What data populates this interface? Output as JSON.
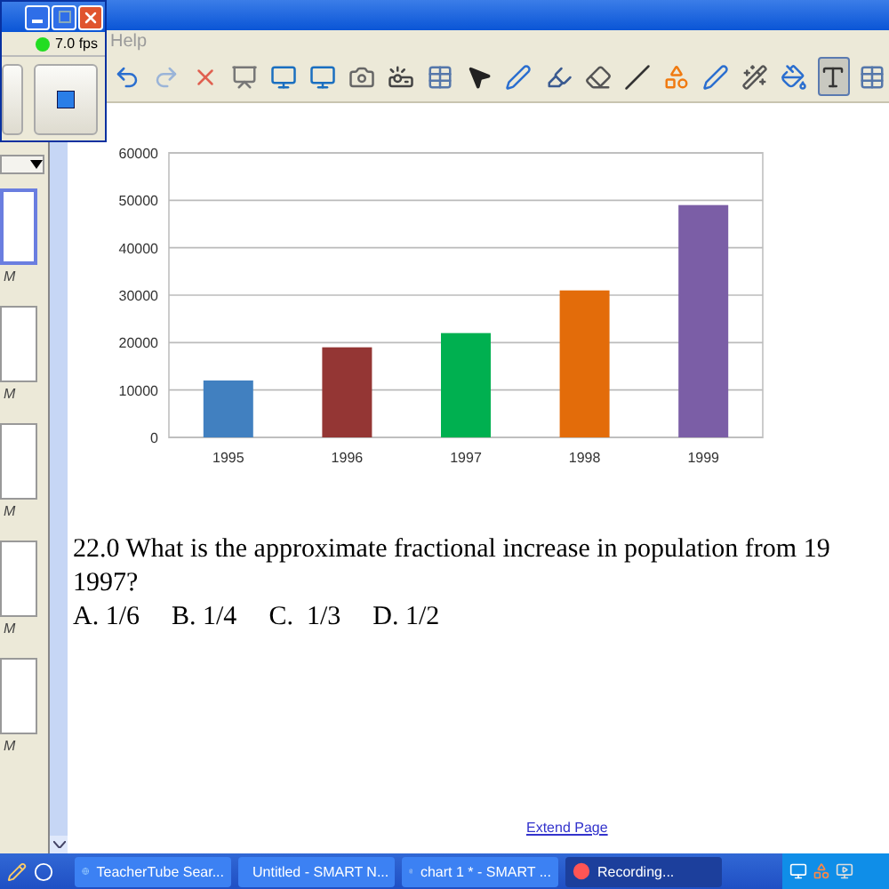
{
  "recorder": {
    "fps": "7.0 fps"
  },
  "menu": [
    "Help"
  ],
  "toolbar": [
    {
      "kind": "undo",
      "selected": false
    },
    {
      "kind": "redo",
      "selected": false
    },
    {
      "kind": "delete",
      "selected": false
    },
    {
      "kind": "screen",
      "selected": false
    },
    {
      "kind": "monitor",
      "selected": false
    },
    {
      "kind": "monitor",
      "selected": false
    },
    {
      "kind": "camera",
      "selected": false
    },
    {
      "kind": "document-camera",
      "selected": false
    },
    {
      "kind": "table",
      "selected": false
    },
    {
      "kind": "pointer",
      "selected": false
    },
    {
      "kind": "pen",
      "selected": false
    },
    {
      "kind": "highlighter",
      "selected": false
    },
    {
      "kind": "eraser",
      "selected": false
    },
    {
      "kind": "line",
      "selected": false
    },
    {
      "kind": "shapes",
      "selected": false
    },
    {
      "kind": "pen",
      "selected": false
    },
    {
      "kind": "magic-pen",
      "selected": false
    },
    {
      "kind": "fill",
      "selected": false
    },
    {
      "kind": "text",
      "selected": true
    },
    {
      "kind": "table",
      "selected": false
    }
  ],
  "pages": [
    {
      "label": "M",
      "selected": true
    },
    {
      "label": "M",
      "selected": false
    },
    {
      "label": "M",
      "selected": false
    },
    {
      "label": "M",
      "selected": false
    },
    {
      "label": "M",
      "selected": false
    }
  ],
  "chart_data": {
    "type": "bar",
    "categories": [
      "1995",
      "1996",
      "1997",
      "1998",
      "1999"
    ],
    "values": [
      12000,
      19000,
      22000,
      31000,
      49000
    ],
    "grid": true,
    "colors": [
      "#4180c0",
      "#943634",
      "#00b050",
      "#e36c0a",
      "#7b5ea6"
    ],
    "ylim": [
      0,
      60000
    ],
    "yticks": [
      0,
      10000,
      20000,
      30000,
      40000,
      50000,
      60000
    ]
  },
  "question": {
    "lines": [
      "22.0 What is the approximate fractional increase in population from 19",
      "1997?"
    ],
    "answers": [
      "A. 1/6",
      "B. 1/4",
      "C.  1/3",
      "D. 1/2"
    ]
  },
  "extend_link": "Extend Page",
  "taskbar": [
    {
      "kind": "browser",
      "label": "TeacherTube Sear...",
      "selected": false
    },
    {
      "kind": "notebook",
      "label": "Untitled - SMART N...",
      "selected": false
    },
    {
      "kind": "notebook",
      "label": "chart 1 * - SMART ...",
      "selected": false
    },
    {
      "kind": "recorder",
      "label": "Recording...",
      "selected": true
    }
  ]
}
